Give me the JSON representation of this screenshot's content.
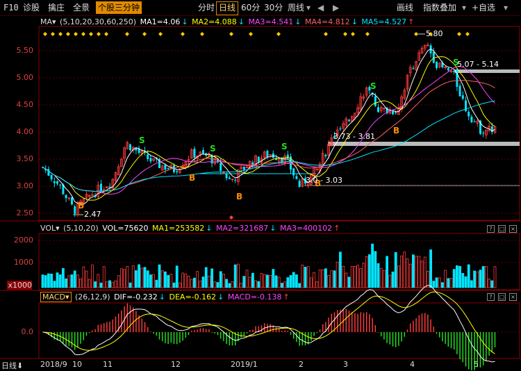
{
  "toolbar": {
    "f10": "F10",
    "items": [
      "诊股",
      "擒庄",
      "全景",
      "个股三分钟"
    ],
    "periods": [
      "分时",
      "日线",
      "60分",
      "30分",
      "周线"
    ],
    "period_dropdown": "▾",
    "right": [
      "画线",
      "指数叠加",
      "+自选"
    ],
    "nav": [
      "◀",
      "▶"
    ]
  },
  "ma": {
    "label": "MA▾",
    "params": "(5,10,20,30,60,250)",
    "ma1": "MA1=4.06",
    "ma2": "MA2=4.088",
    "ma3": "MA3=4.541",
    "ma4": "MA4=4.812",
    "ma5": "MA5=4.527",
    "arrows": [
      "↓",
      "↓",
      "↓",
      "↓",
      "↑"
    ]
  },
  "price_axis": [
    "5.50",
    "5.00",
    "4.50",
    "4.00",
    "3.50",
    "3.00",
    "2.50"
  ],
  "annotations": {
    "high": "5.80",
    "low": "2.47",
    "r1": "5.07 - 5.14",
    "r2": "3.73 - 3.81",
    "r3": "3.0 - 3.03"
  },
  "vol": {
    "label": "VOL▾",
    "params": "(5,10,20)",
    "vol": "VOL=75620",
    "ma1": "MA1=253582",
    "ma2": "MA2=321687",
    "ma3": "MA3=400102",
    "arrows": [
      "↓",
      "↓",
      "↑"
    ],
    "axis": [
      "2000",
      "1000",
      "x1000"
    ]
  },
  "macd": {
    "label": "MACD▾",
    "params": "(26,12,9)",
    "dif": "DIF=-0.232",
    "dea": "DEA=-0.162",
    "macd": "MACD=-0.138",
    "arrows": [
      "↓",
      "↓",
      "↑"
    ],
    "axis": "0.0"
  },
  "bottom": {
    "period": "日线",
    "period_arrow": "⬇",
    "dates": [
      "2018/9",
      "10",
      "11",
      "12",
      "2019/1",
      "2",
      "3",
      "4",
      "5"
    ]
  },
  "colors": {
    "up": "#ff3b3b",
    "down": "#00e5ff",
    "accent": "#e08a00",
    "ma1": "#ffffff",
    "ma2": "#ffff00",
    "ma3": "#ff44ff",
    "ma4": "#ff6060",
    "ma5": "#00ff66"
  }
}
